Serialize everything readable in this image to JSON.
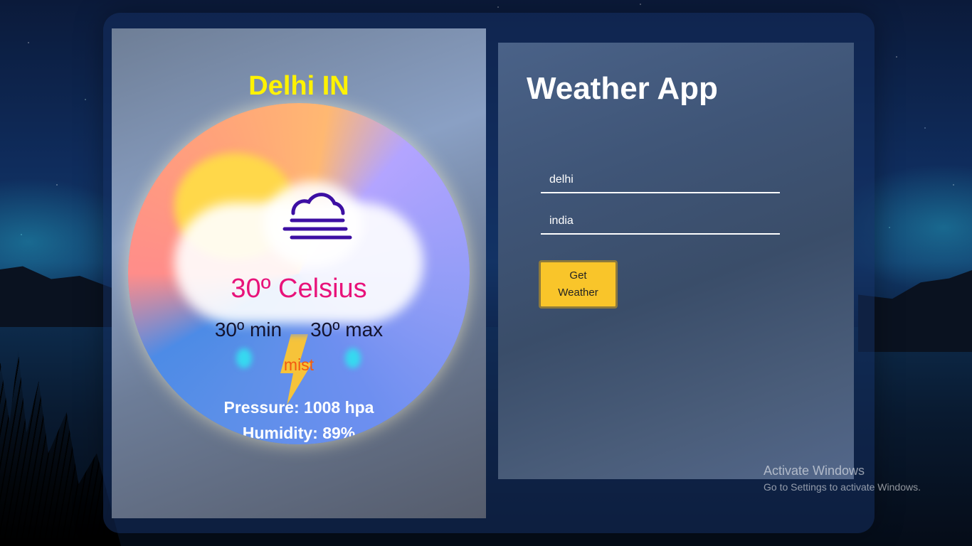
{
  "location": {
    "city_country": "Delhi IN"
  },
  "weather": {
    "icon": "fog-icon",
    "temperature": "30º Celsius",
    "min": "30º min",
    "max": "30º max",
    "description": "mist",
    "pressure": "Pressure: 1008 hpa",
    "humidity": "Humidity: 89%"
  },
  "form": {
    "title": "Weather App",
    "city_value": "delhi",
    "country_value": "india",
    "button_label": "Get Weather"
  },
  "watermark": {
    "title": "Activate Windows",
    "subtitle": "Go to Settings to activate Windows."
  },
  "colors": {
    "city_text": "#fff200",
    "temperature_text": "#e8137a",
    "description_text": "#f25a10",
    "button_bg": "#f9c52a"
  }
}
